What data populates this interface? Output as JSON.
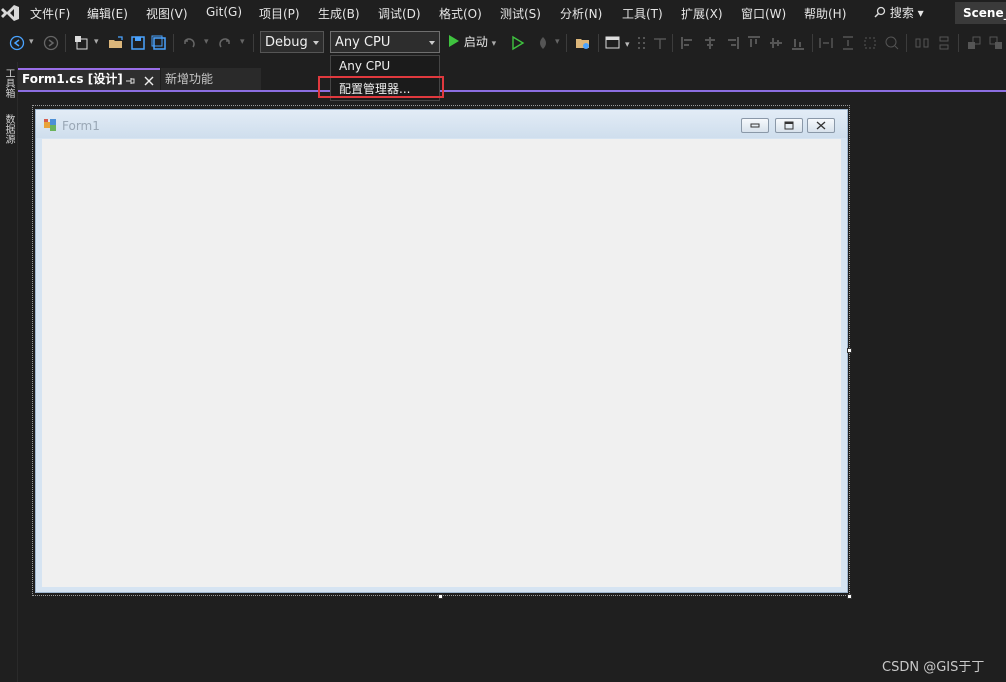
{
  "menubar": {
    "items": [
      "文件(F)",
      "编辑(E)",
      "视图(V)",
      "Git(G)",
      "项目(P)",
      "生成(B)",
      "调试(D)",
      "格式(O)",
      "测试(S)",
      "分析(N)",
      "工具(T)",
      "扩展(X)",
      "窗口(W)",
      "帮助(H)"
    ],
    "search_label": "搜索",
    "solution_name": "Scene_"
  },
  "toolbar": {
    "config_value": "Debug",
    "platform_value": "Any CPU",
    "start_label": "启动"
  },
  "platform_dropdown": {
    "options": [
      "Any CPU",
      "配置管理器..."
    ]
  },
  "left_strip": {
    "toolbox_label": "工具箱",
    "datasource_label": "数据源"
  },
  "tabs": {
    "active_label": "Form1.cs [设计]",
    "inactive_label": "新增功能"
  },
  "form": {
    "title": "Form1"
  },
  "watermark": "CSDN @GIS于丁"
}
